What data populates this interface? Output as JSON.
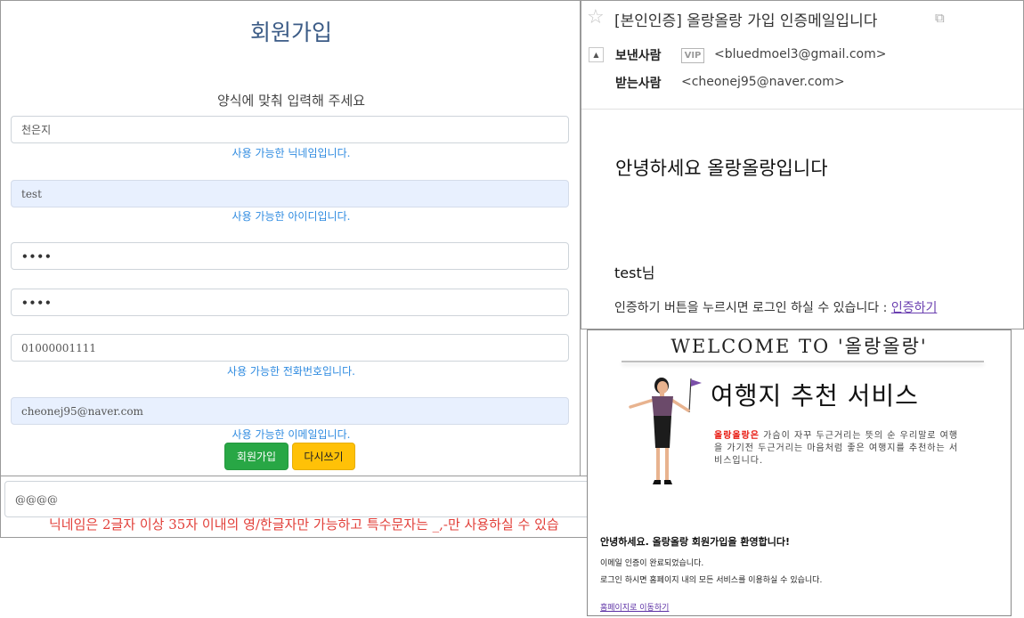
{
  "signup": {
    "title": "회원가입",
    "subtitle": "양식에 맞춰 입력해 주세요",
    "nickname_value": "천은지",
    "nickname_hint": "사용 가능한 닉네임입니다.",
    "id_value": "test",
    "id_hint": "사용 가능한 아이디입니다.",
    "password_value": "••••",
    "password_confirm_value": "••••",
    "phone_value": "01000001111",
    "phone_hint": "사용 가능한 전화번호입니다.",
    "email_value": "cheonej95@naver.com",
    "email_hint": "사용 가능한 이메일입니다.",
    "submit_label": "회원가입",
    "reset_label": "다시쓰기"
  },
  "validation": {
    "input_value": "@@@@",
    "error_text": "닉네임은 2글자 이상 35자 이내의 영/한글자만 가능하고 특수문자는 _,-만 사용하실 수 있습"
  },
  "email": {
    "star_icon": "☆",
    "subject": "[본인인증] 올랑올랑 가입 인증메일입니다",
    "external_icon": "⧉",
    "toggle_icon": "▲",
    "from_label": "보낸사람",
    "vip_badge": "VIP",
    "from_address": "<bluedmoel3@gmail.com>",
    "to_label": "받는사람",
    "to_address": "<cheonej95@naver.com>",
    "greeting": "안녕하세요 올랑올랑입니다",
    "user_line": "test님",
    "body_text": "인증하기 버튼을 누르시면 로그인 하실 수 있습니다 : ",
    "verify_link": "인증하기"
  },
  "welcome": {
    "title": "WELCOME TO '올랑올랑'",
    "service_title": "여행지 추천 서비스",
    "brand": "올랑올랑은",
    "description": " 가슴이 자꾸 두근거리는 뜻의 순 우리말로 여행을 가기전 두근거리는 마음처럼 좋은 여행지를 추천하는 서비스입니다.",
    "welcome_line": "안녕하세요. 올랑올랑 회원가입을 환영합니다!",
    "complete_line": "이메일 인증이 완료되었습니다.",
    "login_line": "로그인 하시면 홈페이지 내의 모든 서비스를 이용하실 수 있습니다.",
    "home_link": "홈페이지로 이동하기"
  },
  "colors": {
    "title_blue": "#3b5b86",
    "hint_blue": "#2f8be0",
    "error_red": "#e2403a",
    "success_green": "#28a745",
    "warning_yellow": "#ffc107",
    "link_purple": "#6a3fb0",
    "brand_red": "#e8180f"
  }
}
